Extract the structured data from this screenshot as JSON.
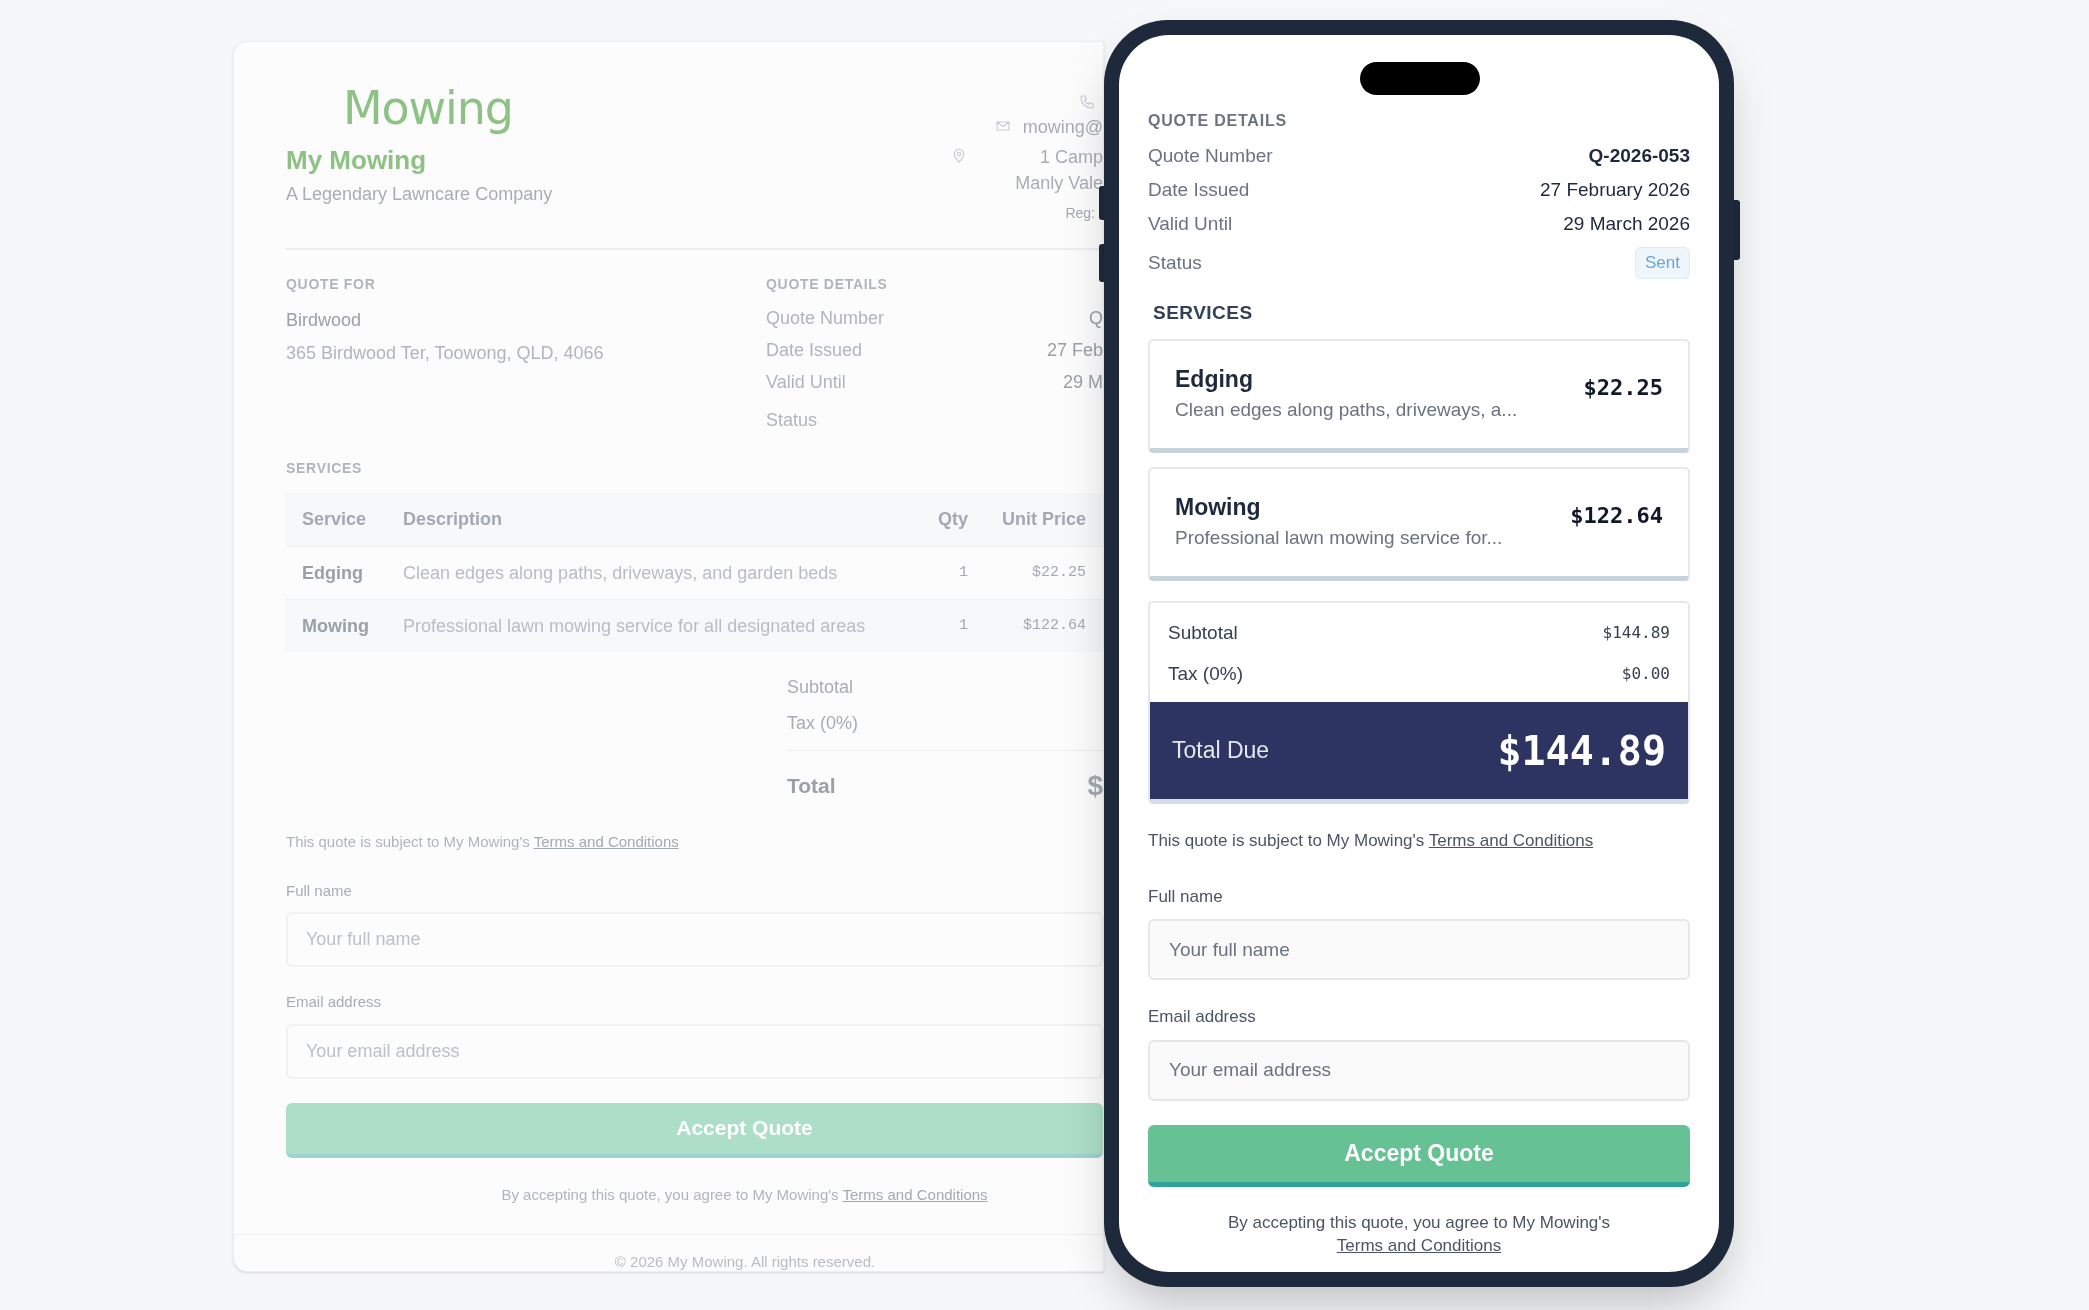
{
  "quote_page": {
    "logo": "Mowing",
    "company_name": "My Mowing",
    "tagline": "A Legendary Lawncare Company",
    "contact": [
      {
        "kind": "phone"
      },
      {
        "kind": "email",
        "lines": [
          "mowing@"
        ]
      },
      {
        "kind": "address",
        "lines": [
          "1 Camp",
          "Manly Vale"
        ]
      }
    ],
    "registration": "Reg:",
    "quote_for": {
      "heading": "QUOTE FOR",
      "name": "Birdwood",
      "address": "365 Birdwood Ter, Toowong, QLD, 4066"
    },
    "quote_details": {
      "heading": "QUOTE DETAILS",
      "rows": [
        {
          "label": "Quote Number",
          "value": "Q"
        },
        {
          "label": "Date Issued",
          "value": "27 Feb"
        },
        {
          "label": "Valid Until",
          "value": "29 M"
        }
      ],
      "status_label": "Status"
    },
    "services_heading": "SERVICES",
    "table": {
      "columns": [
        "Service",
        "Description",
        "Qty",
        "Unit Price"
      ],
      "rows": [
        [
          "Edging",
          "Clean edges along paths, driveways, and garden beds",
          "1",
          "$22.25"
        ],
        [
          "Mowing",
          "Professional lawn mowing service for all designated areas",
          "1",
          "$122.64"
        ]
      ]
    },
    "totals": {
      "rows": [
        "Subtotal",
        "Tax (0%)"
      ],
      "total_label": "Total",
      "total_value": "$"
    },
    "terms": {
      "text": "This quote is subject to My Mowing's",
      "link": "Terms and Conditions"
    },
    "fields": [
      {
        "label": "Full name",
        "placeholder": "Your full name"
      },
      {
        "label": "Email address",
        "placeholder": "Your email address"
      }
    ],
    "button": "Accept Quote",
    "agreement": {
      "text": "By accepting this quote, you agree to My Mowing's",
      "link": "Terms and Conditions"
    },
    "copyright": "© 2026 My Mowing. All rights reserved."
  },
  "phone": {
    "details_heading": "QUOTE DETAILS",
    "details": [
      {
        "label": "Quote Number",
        "value": "Q-2026-053"
      },
      {
        "label": "Date Issued",
        "value": "27 February 2026"
      },
      {
        "label": "Valid Until",
        "value": "29 March 2026"
      }
    ],
    "status": {
      "label": "Status",
      "value": "Sent"
    },
    "services_heading": "SERVICES",
    "services": [
      {
        "name": "Edging",
        "description": "Clean edges along paths, driveways, a...",
        "price": "$22.25"
      },
      {
        "name": "Mowing",
        "description": "Professional lawn mowing service for...",
        "price": "$122.64"
      }
    ],
    "totals": [
      {
        "label": "Subtotal",
        "value": "$144.89"
      },
      {
        "label": "Tax (0%)",
        "value": "$0.00"
      }
    ],
    "total": {
      "label": "Total Due",
      "value": "$144.89"
    },
    "terms": {
      "text": "This quote is subject to My Mowing's",
      "link": "Terms and Conditions"
    },
    "fields": [
      {
        "label": "Full name",
        "placeholder": "Your full name"
      },
      {
        "label": "Email address",
        "placeholder": "Your email address"
      }
    ],
    "button": "Accept Quote",
    "agreement": {
      "text": "By accepting this quote, you agree to My Mowing's",
      "link": "Terms and Conditions"
    }
  }
}
